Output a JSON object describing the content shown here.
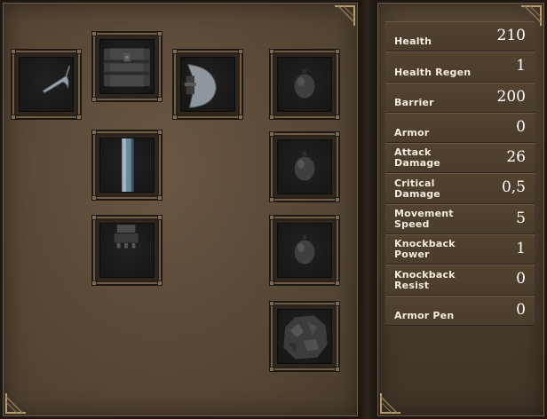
{
  "equipment": {
    "slots": [
      {
        "id": "weapon-scythe",
        "icon": "scythe-blade-icon"
      },
      {
        "id": "chest-armor",
        "icon": "chestplate-icon"
      },
      {
        "id": "offhand-axe",
        "icon": "axe-head-icon"
      },
      {
        "id": "ring-1",
        "icon": "gem-orb-icon"
      },
      {
        "id": "legs",
        "icon": "leg-greave-icon"
      },
      {
        "id": "ring-2",
        "icon": "gem-orb-icon"
      },
      {
        "id": "boots",
        "icon": "boot-icon"
      },
      {
        "id": "ring-3",
        "icon": "gem-orb-icon"
      },
      {
        "id": "relic-stone",
        "icon": "stone-relic-icon"
      }
    ]
  },
  "stats": [
    {
      "name": "Health",
      "value": "210"
    },
    {
      "name": "Health Regen",
      "value": "1"
    },
    {
      "name": "Barrier",
      "value": "200"
    },
    {
      "name": "Armor",
      "value": "0"
    },
    {
      "name": "Attack Damage",
      "value": "26"
    },
    {
      "name": "Critical Damage",
      "value": "0,5"
    },
    {
      "name": "Movement Speed",
      "value": "5"
    },
    {
      "name": "Knockback Power",
      "value": "1"
    },
    {
      "name": "Knockback Resist",
      "value": "0"
    },
    {
      "name": "Armor Pen",
      "value": "0"
    }
  ],
  "colors": {
    "panel": "#5a4a38",
    "slot_frame": "#6e5c46",
    "slot_bg": "#151515",
    "text": "#f3ece0"
  }
}
